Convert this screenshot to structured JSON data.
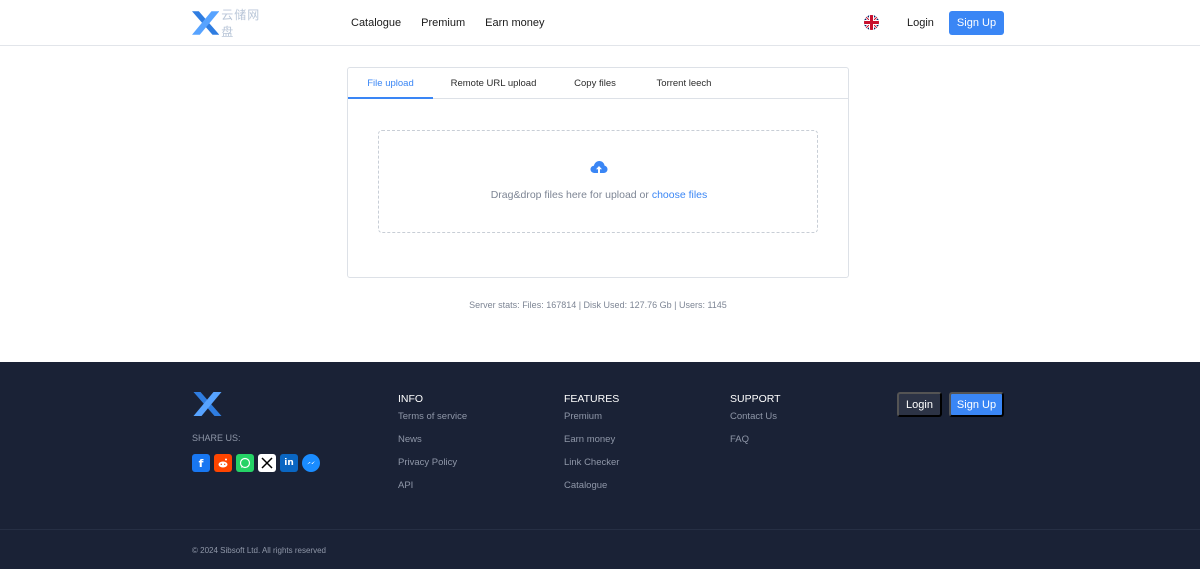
{
  "header": {
    "logo_text": "云储网盘",
    "nav": [
      "Catalogue",
      "Premium",
      "Earn money"
    ],
    "login": "Login",
    "signup": "Sign Up"
  },
  "upload": {
    "tabs": [
      "File upload",
      "Remote URL upload",
      "Copy files",
      "Torrent leech"
    ],
    "active_tab": "File upload",
    "drop_text": "Drag&drop files here for upload or ",
    "choose_link": "choose files"
  },
  "stats": "Server stats: Files: 167814 | Disk Used: 127.76 Gb | Users: 1145",
  "footer": {
    "share_label": "SHARE US:",
    "socials": [
      "facebook-icon",
      "reddit-icon",
      "whatsapp-icon",
      "x-icon",
      "linkedin-icon",
      "messenger-icon"
    ],
    "columns": [
      {
        "title": "INFO",
        "links": [
          "Terms of service",
          "News",
          "Privacy Policy",
          "API"
        ]
      },
      {
        "title": "FEATURES",
        "links": [
          "Premium",
          "Earn money",
          "Link Checker",
          "Catalogue"
        ]
      },
      {
        "title": "SUPPORT",
        "links": [
          "Contact Us",
          "FAQ"
        ]
      }
    ],
    "login": "Login",
    "signup": "Sign Up",
    "copyright": "© 2024 Sibsoft Ltd. All rights reserved"
  },
  "colors": {
    "accent": "#3a86f5",
    "footer_bg": "#1a2236"
  }
}
